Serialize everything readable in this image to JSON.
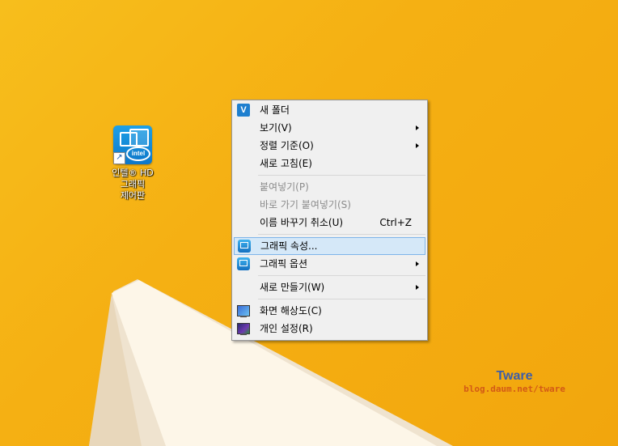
{
  "desktop": {
    "colors": {
      "background": "#f5b013",
      "shape_light": "#fdf6e8",
      "shape_shadow": "#efe3cf"
    },
    "shortcut": {
      "icon_name": "intel-graphics-icon",
      "label_lines": [
        "인텔® HD",
        "그래픽",
        "제어판"
      ],
      "icon_text": "intel"
    }
  },
  "context_menu": {
    "items": [
      {
        "label": "새 폴더",
        "icon": "v-icon"
      },
      {
        "label": "보기(V)",
        "submenu": true
      },
      {
        "label": "정렬 기준(O)",
        "submenu": true
      },
      {
        "label": "새로 고침(E)"
      },
      {
        "label": "붙여넣기(P)",
        "disabled": true
      },
      {
        "label": "바로 가기 붙여넣기(S)",
        "disabled": true
      },
      {
        "label": "이름 바꾸기 취소(U)",
        "shortcut": "Ctrl+Z"
      },
      {
        "label": "그래픽 속성...",
        "icon": "intel-graphics-icon",
        "highlighted": true
      },
      {
        "label": "그래픽 옵션",
        "icon": "intel-graphics-icon",
        "submenu": true
      },
      {
        "label": "새로 만들기(W)",
        "submenu": true
      },
      {
        "label": "화면 해상도(C)",
        "icon": "monitor-icon"
      },
      {
        "label": "개인 설정(R)",
        "icon": "personalize-icon"
      }
    ]
  },
  "watermark": {
    "brand": "Tware",
    "url": "blog.daum.net/tware"
  }
}
